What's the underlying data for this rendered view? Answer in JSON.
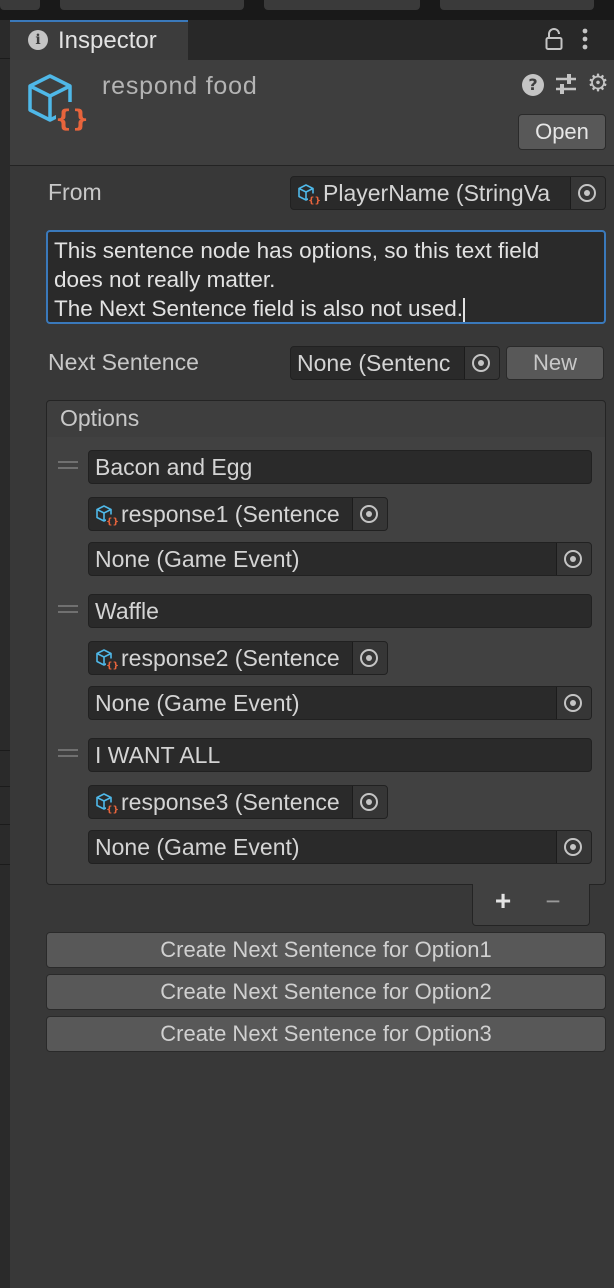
{
  "window": {
    "tab_label": "Inspector",
    "icons": {
      "info": "info-icon",
      "lock": "lock-icon",
      "more": "kebab-menu-icon"
    }
  },
  "header": {
    "title": "respond food",
    "help_glyph": "?",
    "open_label": "Open",
    "icons": {
      "asset": "scriptable-object-icon",
      "help": "help-icon",
      "presets": "sliders-icon",
      "settings": "gear-icon"
    }
  },
  "fields": {
    "from_label": "From",
    "from_value": "PlayerName (StringVa",
    "text_lines": [
      "This sentence node has options, so this text field",
      "does not really matter.",
      "The Next Sentence field is also not used."
    ],
    "next_sentence_label": "Next Sentence",
    "next_sentence_value": "None (Sentenc",
    "new_label": "New"
  },
  "options": {
    "title": "Options",
    "items": [
      {
        "text": "Bacon and Egg",
        "sentence": "response1 (Sentence",
        "event": "None (Game Event)"
      },
      {
        "text": "Waffle",
        "sentence": "response2 (Sentence",
        "event": "None (Game Event)"
      },
      {
        "text": "I WANT ALL",
        "sentence": "response3 (Sentence",
        "event": "None (Game Event)"
      }
    ],
    "add_glyph": "+",
    "remove_glyph": "−"
  },
  "buttons": [
    "Create Next Sentence for Option1",
    "Create Next Sentence for Option2",
    "Create Next Sentence for Option3"
  ],
  "colors": {
    "accent": "#3a79bb",
    "icon_cube": "#4fb8e8",
    "icon_braces": "#e8643c"
  }
}
